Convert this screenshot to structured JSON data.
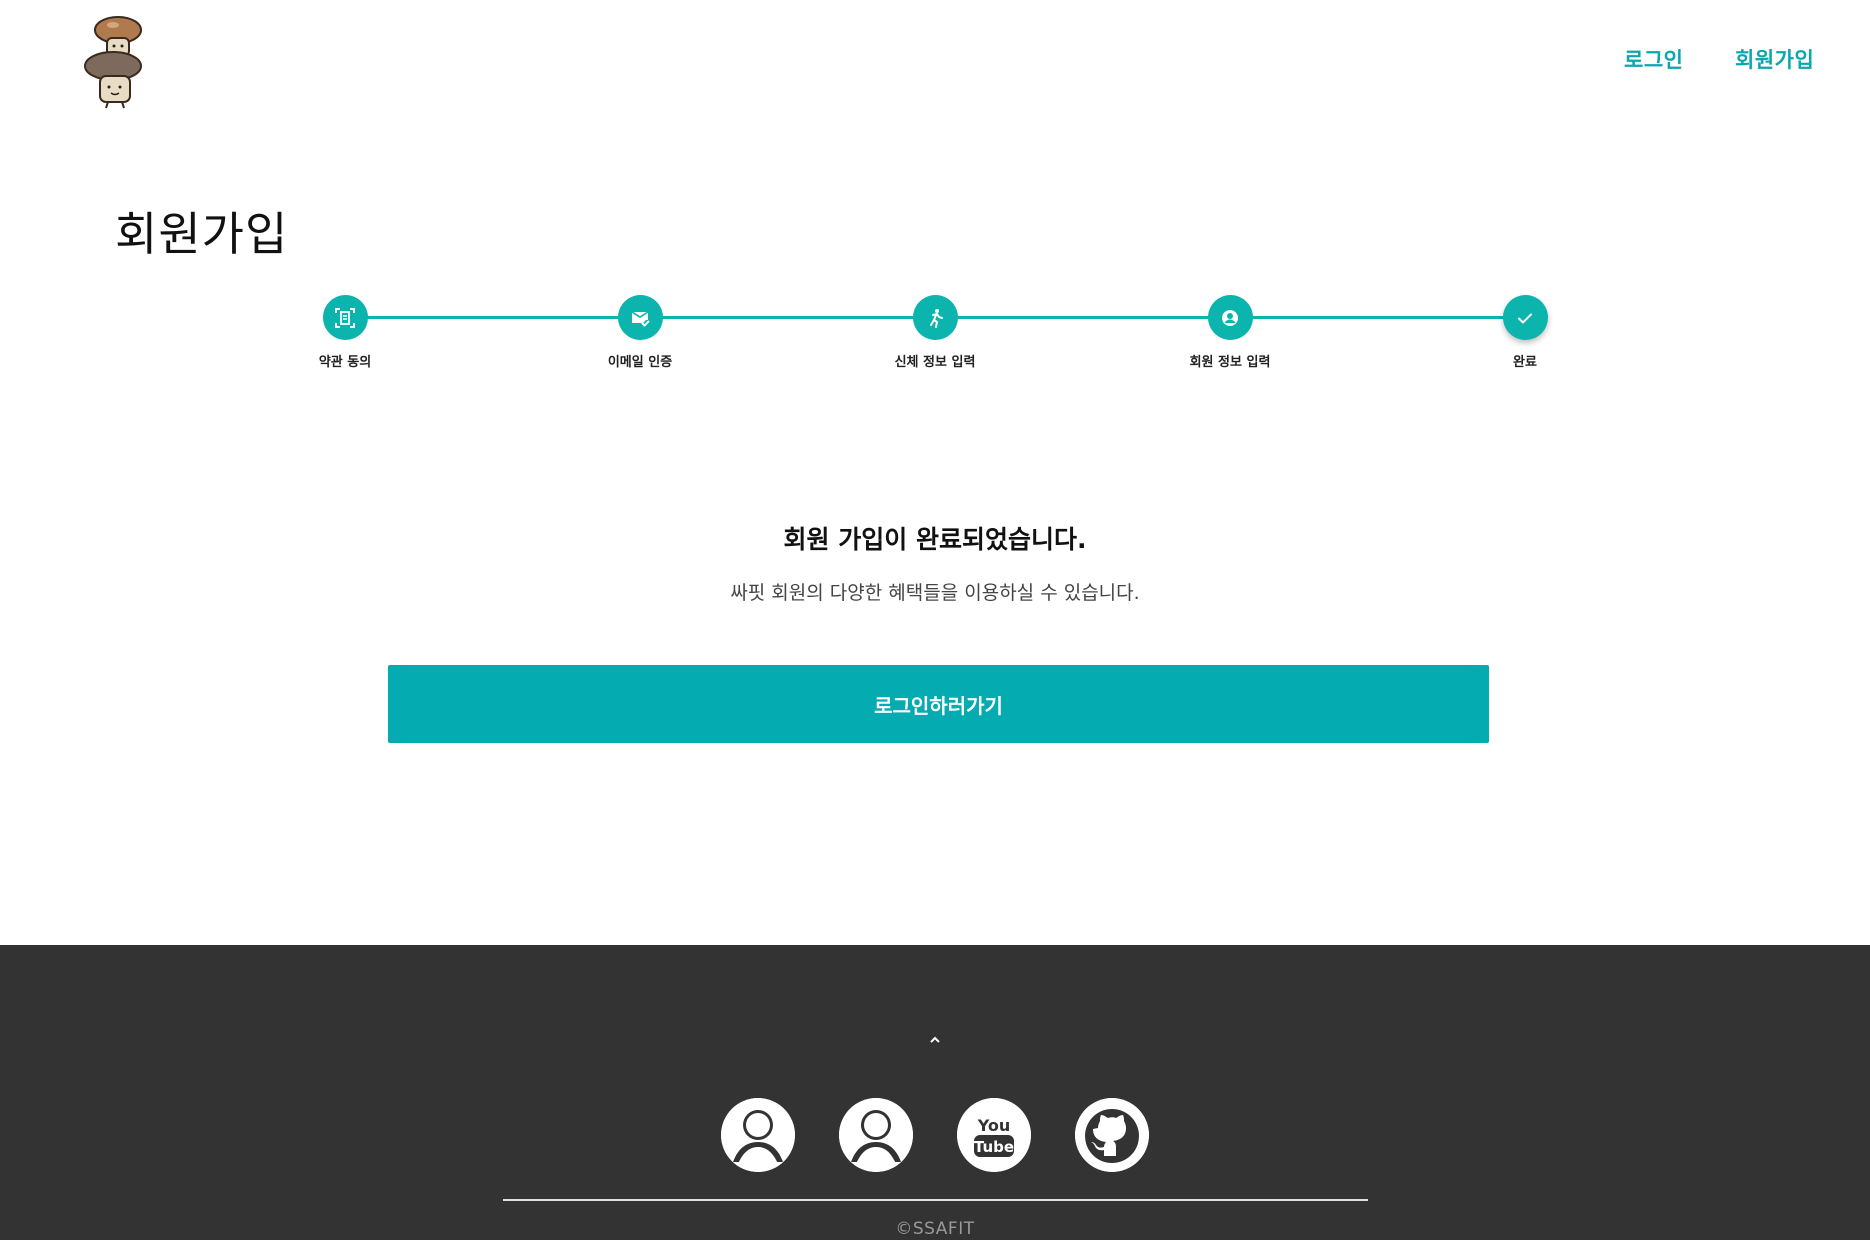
{
  "header": {
    "logo_icon": "mushroom-mascot-logo",
    "nav": {
      "login_label": "로그인",
      "signup_label": "회원가입"
    }
  },
  "page_title": "회원가입",
  "stepper": {
    "accent_color": "#0bb5ae",
    "steps": [
      {
        "label": "약관 동의",
        "icon": "document-scan-icon"
      },
      {
        "label": "이메일 인증",
        "icon": "mail-check-icon"
      },
      {
        "label": "신체 정보 입력",
        "icon": "running-person-icon"
      },
      {
        "label": "회원 정보 입력",
        "icon": "account-circle-icon"
      },
      {
        "label": "완료",
        "icon": "checkmark-icon"
      }
    ]
  },
  "completion": {
    "title": "회원 가입이 완료되었습니다.",
    "subtitle": "싸핏 회원의 다양한 혜택들을 이용하실 수 있습니다.",
    "button_label": "로그인하러가기",
    "button_color": "#04abb1"
  },
  "footer": {
    "background": "#333333",
    "scroll_top_icon": "chevron-up-icon",
    "social_icons": [
      "person-avatar-icon",
      "person-avatar-icon",
      "youtube-icon",
      "github-icon"
    ],
    "youtube_text_top": "You",
    "youtube_text_bottom": "Tube",
    "copyright": "©SSAFIT"
  }
}
